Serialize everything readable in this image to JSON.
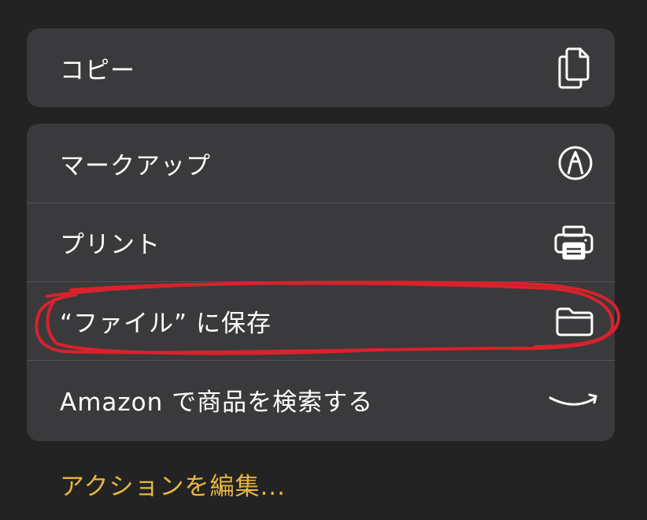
{
  "menu": {
    "copy_group": [
      {
        "label": "コピー",
        "icon": "copy-documents-icon"
      }
    ],
    "actions_group": [
      {
        "label": "マークアップ",
        "icon": "markup-pen-icon"
      },
      {
        "label": "プリント",
        "icon": "printer-icon"
      },
      {
        "label": "“ファイル” に保存",
        "icon": "folder-icon"
      },
      {
        "label": "Amazon で商品を検索する",
        "icon": "amazon-smile-icon"
      }
    ]
  },
  "edit_actions": {
    "label": "アクションを編集..."
  },
  "colors": {
    "background": "#232323",
    "cell": "#3a3a3c",
    "separator": "#545458",
    "text": "#ffffff",
    "accent": "#e8b740",
    "annotation": "#d9222c"
  }
}
